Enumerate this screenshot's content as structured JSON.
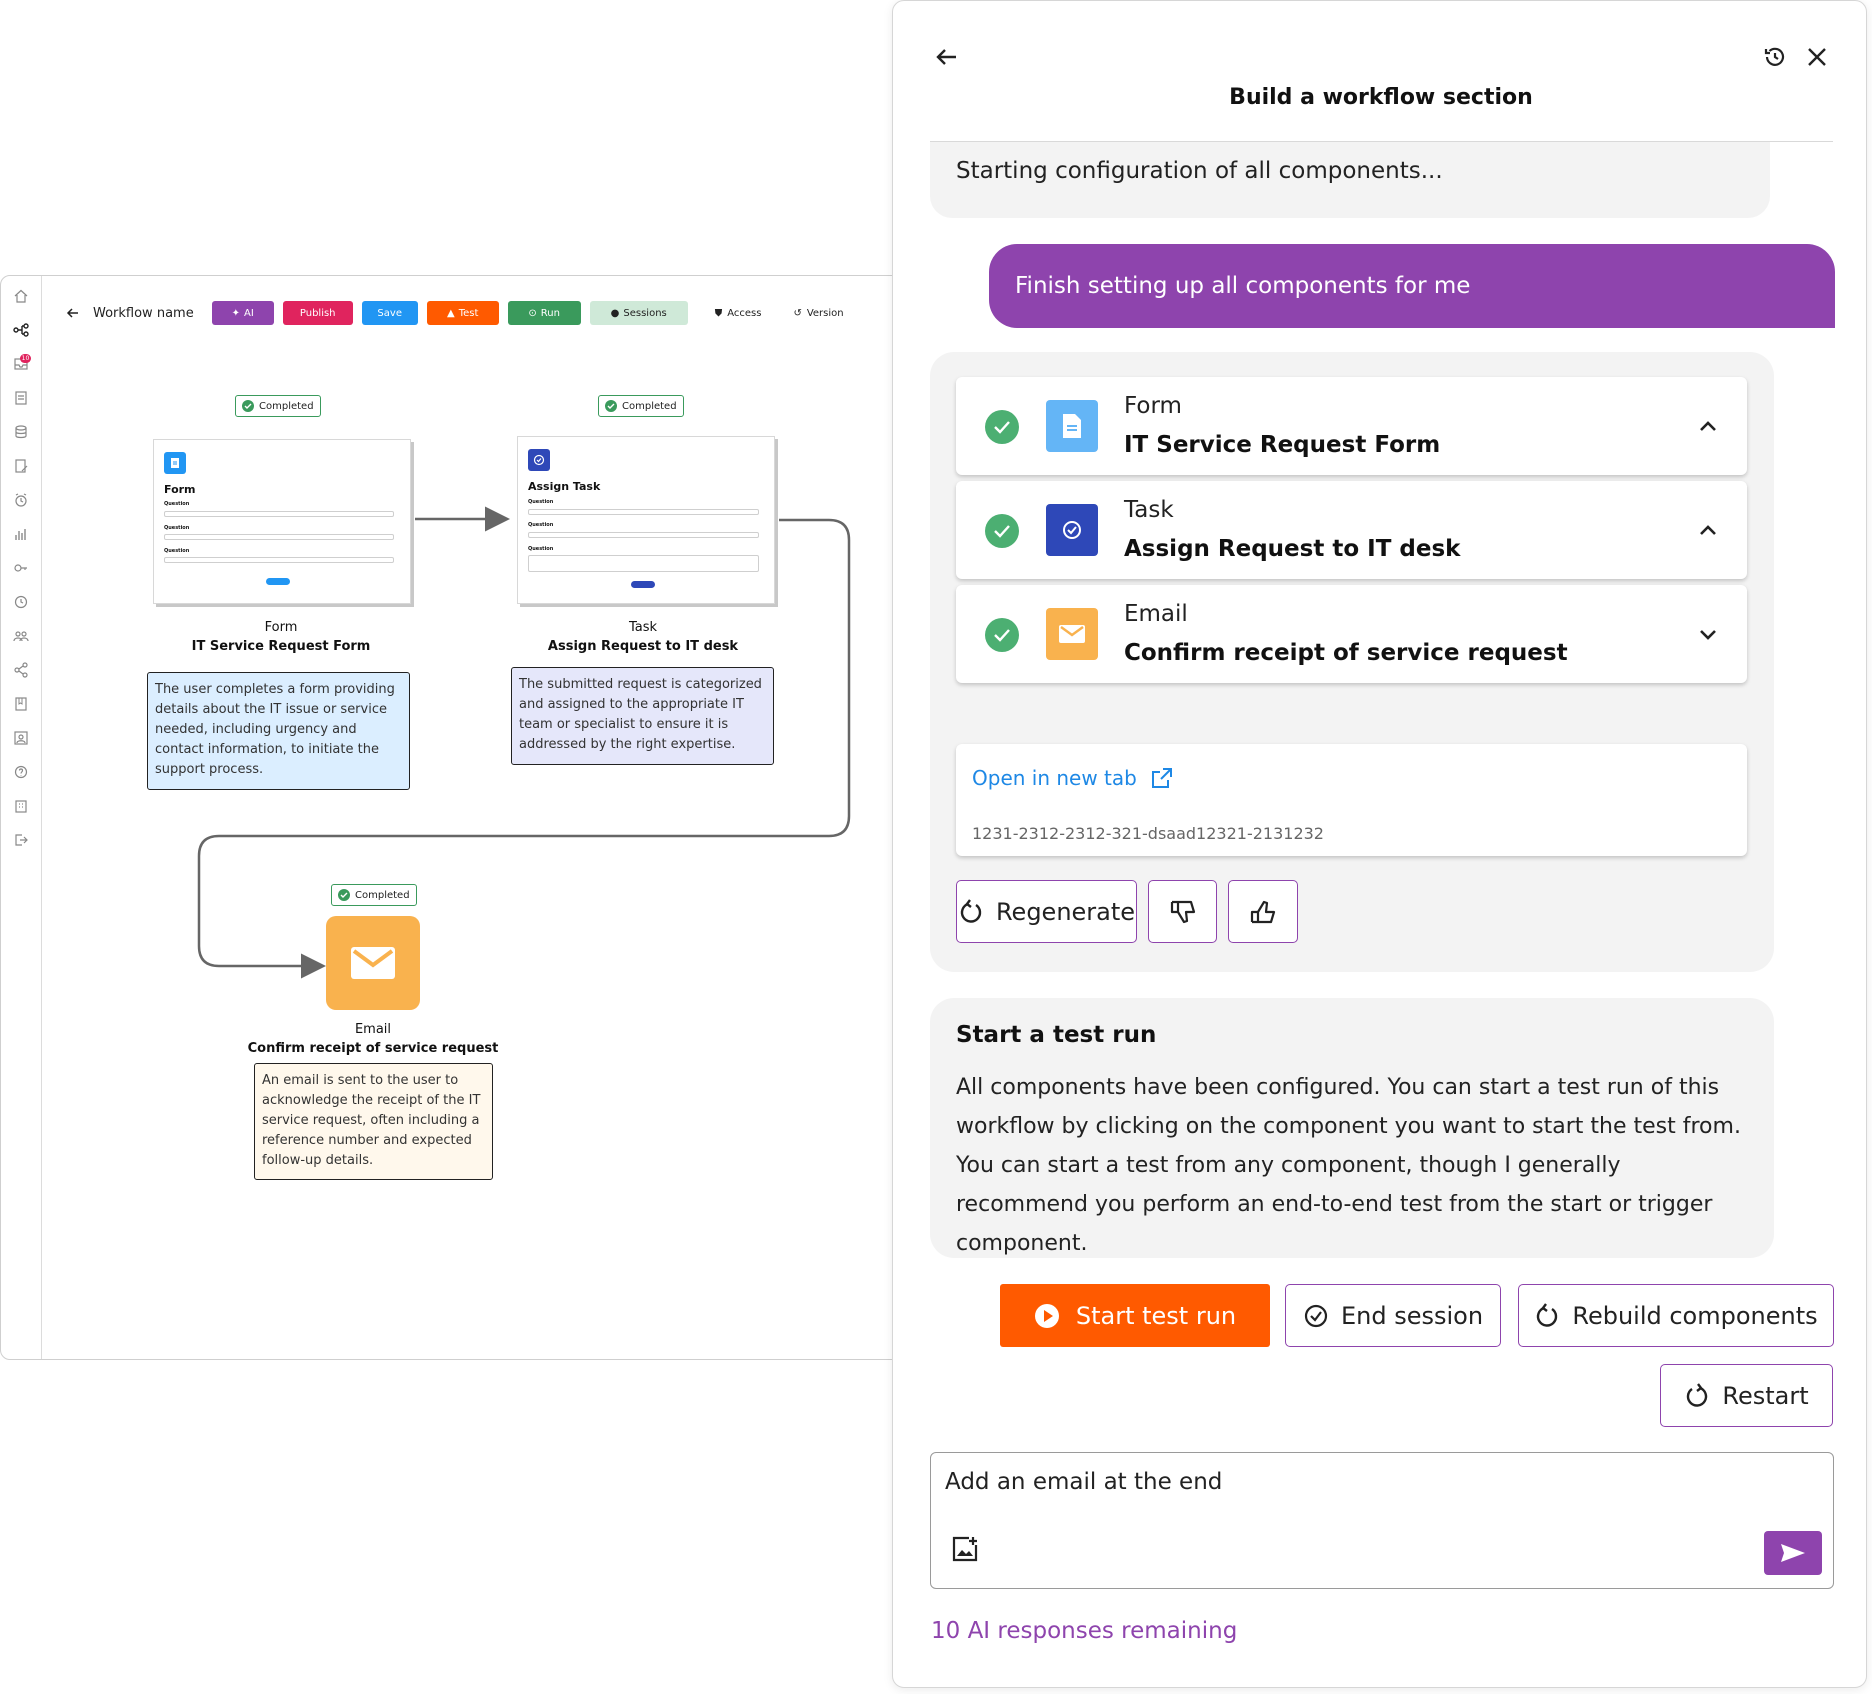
{
  "editor": {
    "title": "Workflow name",
    "toolbar": {
      "ai": "AI",
      "publish": "Publish",
      "save": "Save",
      "test": "Test",
      "run": "Run",
      "sessions": "Sessions",
      "access": "Access",
      "version": "Version"
    },
    "rail_badge": "10",
    "colors": {
      "ai": "#8e44ad",
      "publish": "#e0245e",
      "save": "#2196f3",
      "test": "#ff5a00",
      "run": "#3a9a5c",
      "sessions": "#cfe9d8"
    },
    "nodes": [
      {
        "status": "Completed",
        "type": "Form",
        "name": "IT Service Request Form",
        "card_title": "Form",
        "question": "Question",
        "description": "The user completes a form providing details about the IT issue or service needed, including urgency and contact information, to initiate the support process."
      },
      {
        "status": "Completed",
        "type": "Task",
        "name": "Assign Request to IT desk",
        "card_title": "Assign Task",
        "question": "Question",
        "description": "The submitted request is categorized and assigned to the appropriate IT team or specialist to ensure it is addressed by the right expertise."
      },
      {
        "status": "Completed",
        "type": "Email",
        "name": "Confirm receipt of service request",
        "description": "An email is sent to the user to acknowledge the receipt of the IT service request, often including a reference number and expected follow-up details."
      }
    ]
  },
  "panel": {
    "title": "Build a workflow section",
    "system_message": "Starting configuration of all components...",
    "user_message": "Finish setting up all components for me",
    "components": [
      {
        "type": "Form",
        "name": "IT Service Request Form",
        "icon": "document-icon",
        "color": "#64b5f6",
        "expanded": true
      },
      {
        "type": "Task",
        "name": "Assign Request to IT desk",
        "icon": "task-check-icon",
        "color": "#2e48b8",
        "expanded": true
      },
      {
        "type": "Email",
        "name": "Confirm receipt of service request",
        "icon": "envelope-icon",
        "color": "#f9b24e",
        "expanded": false
      }
    ],
    "open_link": "Open in new tab",
    "component_id": "1231-2312-2312-321-dsaad12321-2131232",
    "regenerate": "Regenerate",
    "test_title": "Start a test run",
    "test_body": "All components have been configured. You can start a test run of this workflow by clicking on the component you want to start the test from. You can start a test from any component, though I generally recommend you perform an end-to-end test from the start or trigger component.",
    "start_test": "Start test run",
    "end_session": "End session",
    "rebuild": "Rebuild components",
    "restart": "Restart",
    "input_value": "Add an email at the end",
    "remaining": "10 AI responses remaining",
    "accent": "#8e44ad"
  }
}
